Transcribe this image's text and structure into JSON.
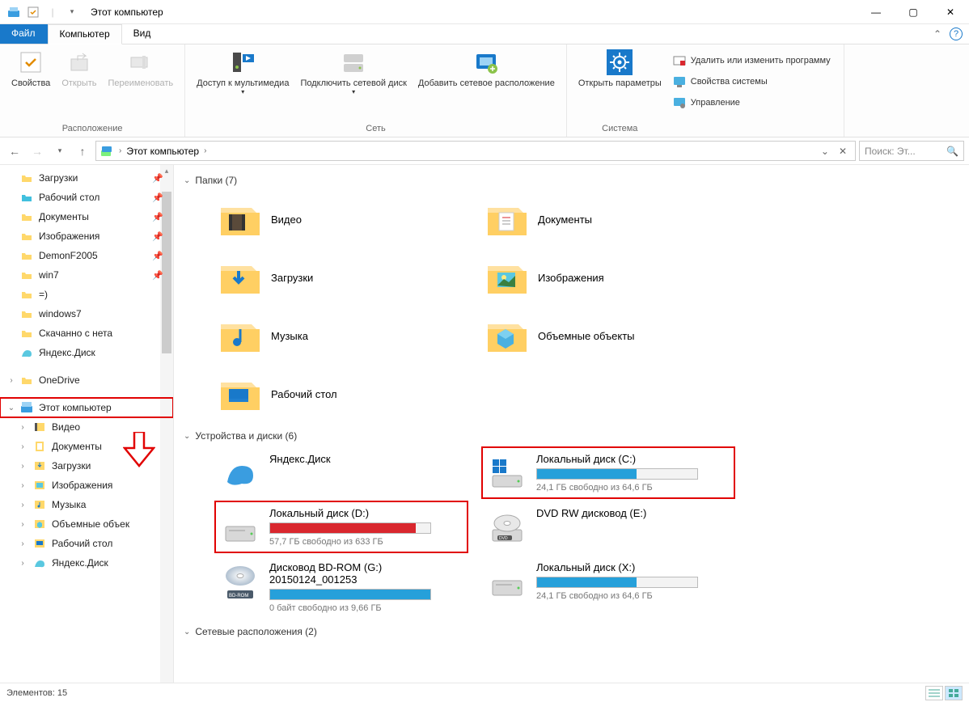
{
  "window": {
    "title": "Этот компьютер",
    "minimize": "—",
    "maximize": "▢",
    "close": "✕"
  },
  "tabs": {
    "file": "Файл",
    "computer": "Компьютер",
    "view": "Вид"
  },
  "ribbon": {
    "location": {
      "properties": "Свойства",
      "open": "Открыть",
      "rename": "Переименовать",
      "group": "Расположение"
    },
    "network": {
      "media": "Доступ к мультимедиа",
      "mapdrive": "Подключить сетевой диск",
      "addloc": "Добавить сетевое расположение",
      "group": "Сеть"
    },
    "system": {
      "settings": "Открыть параметры",
      "uninstall": "Удалить или изменить программу",
      "sysprop": "Свойства системы",
      "manage": "Управление",
      "group": "Система"
    }
  },
  "nav": {
    "breadcrumb": "Этот компьютер",
    "chev": "›",
    "search_placeholder": "Поиск: Эт..."
  },
  "sidebar": [
    {
      "label": "Загрузки",
      "pin": true,
      "icon": "folder-yellow"
    },
    {
      "label": "Рабочий стол",
      "pin": true,
      "icon": "folder-blue"
    },
    {
      "label": "Документы",
      "pin": true,
      "icon": "folder-yellow"
    },
    {
      "label": "Изображения",
      "pin": true,
      "icon": "folder-yellow"
    },
    {
      "label": "DemonF2005",
      "pin": true,
      "icon": "folder-yellow"
    },
    {
      "label": "win7",
      "pin": true,
      "icon": "folder-yellow"
    },
    {
      "label": "=)",
      "pin": false,
      "icon": "folder-yellow"
    },
    {
      "label": "windows7",
      "pin": false,
      "icon": "folder-yellow"
    },
    {
      "label": "Скачанно с нета",
      "pin": false,
      "icon": "folder-yellow"
    },
    {
      "label": "Яндекс.Диск",
      "pin": false,
      "icon": "yandex"
    },
    {
      "label": "",
      "blank": true
    },
    {
      "label": "OneDrive",
      "exp": ">",
      "icon": "folder-yellow"
    },
    {
      "label": "",
      "blank": true
    },
    {
      "label": "Этот компьютер",
      "exp": "v",
      "icon": "computer",
      "highlight": true
    },
    {
      "label": "Видео",
      "exp": ">",
      "indent": true,
      "icon": "film"
    },
    {
      "label": "Документы",
      "exp": ">",
      "indent": true,
      "icon": "doc"
    },
    {
      "label": "Загрузки",
      "exp": ">",
      "indent": true,
      "icon": "download"
    },
    {
      "label": "Изображения",
      "exp": ">",
      "indent": true,
      "icon": "image"
    },
    {
      "label": "Музыка",
      "exp": ">",
      "indent": true,
      "icon": "music"
    },
    {
      "label": "Объемные объек",
      "exp": ">",
      "indent": true,
      "icon": "cube"
    },
    {
      "label": "Рабочий стол",
      "exp": ">",
      "indent": true,
      "icon": "desktop"
    },
    {
      "label": "Яндекс.Диск",
      "exp": ">",
      "indent": true,
      "icon": "yandex"
    }
  ],
  "sections": {
    "folders": "Папки (7)",
    "drives": "Устройства и диски (6)",
    "network": "Сетевые расположения (2)"
  },
  "folders": [
    {
      "label": "Видео",
      "icon": "video"
    },
    {
      "label": "Документы",
      "icon": "documents"
    },
    {
      "label": "Загрузки",
      "icon": "downloads"
    },
    {
      "label": "Изображения",
      "icon": "pictures"
    },
    {
      "label": "Музыка",
      "icon": "music"
    },
    {
      "label": "Объемные объекты",
      "icon": "objects3d"
    },
    {
      "label": "Рабочий стол",
      "icon": "desktop"
    }
  ],
  "drives": [
    {
      "name": "Яндекс.Диск",
      "icon": "yandex",
      "no_bar": true
    },
    {
      "name": "Локальный диск (C:)",
      "free": "24,1 ГБ свободно из 64,6 ГБ",
      "fill": 62,
      "color": "#26a0da",
      "icon": "drive-win",
      "highlight": true
    },
    {
      "name": "Локальный диск (D:)",
      "free": "57,7 ГБ свободно из 633 ГБ",
      "fill": 91,
      "color": "#d9272e",
      "icon": "drive",
      "highlight": true
    },
    {
      "name": "DVD RW дисковод (E:)",
      "icon": "dvd",
      "no_bar": true
    },
    {
      "name": "Дисковод BD-ROM (G:) 20150124_001253",
      "free": "0 байт свободно из 9,66 ГБ",
      "fill": 100,
      "color": "#26a0da",
      "icon": "bdrom"
    },
    {
      "name": "Локальный диск (X:)",
      "free": "24,1 ГБ свободно из 64,6 ГБ",
      "fill": 62,
      "color": "#26a0da",
      "icon": "drive"
    }
  ],
  "status": {
    "count": "Элементов: 15"
  }
}
